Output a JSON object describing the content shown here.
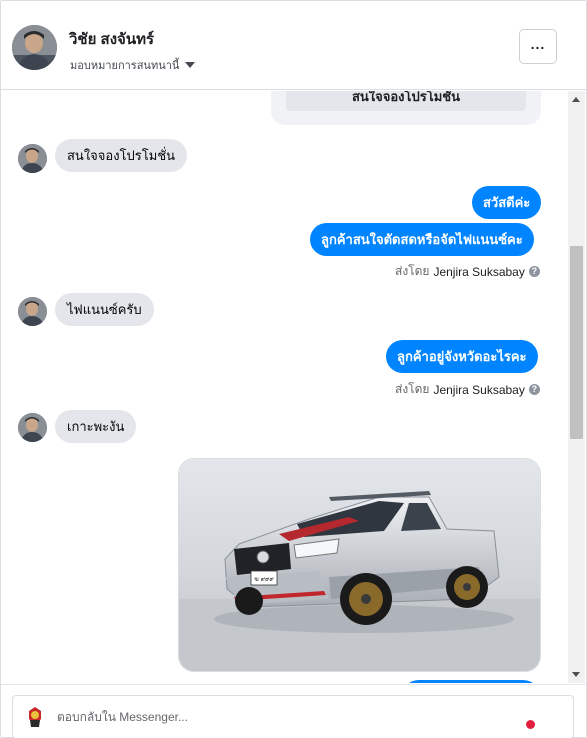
{
  "header": {
    "name": "วิชัย สงจันทร์",
    "assign_label": "มอบหมายการสนทนานี้"
  },
  "conversation": {
    "card_button_label": "สนใจจองโปรโมชัน",
    "messages": [
      {
        "from": "customer",
        "text": "สนใจจองโปรโมชั่น"
      },
      {
        "from": "page",
        "text": "สวัสดีค่ะ"
      },
      {
        "from": "page",
        "text": "ลูกค้าสนใจตัดสดหรือจัดไฟแนนซ์คะ"
      },
      {
        "from": "customer",
        "text": "ไฟแนนซ์ครับ"
      },
      {
        "from": "page",
        "text": "ลูกค้าอยู่จังหวัดอะไรคะ"
      },
      {
        "from": "customer",
        "text": "เกาะพะงัน"
      }
    ],
    "sent_by_prefix": "ส่งโดย",
    "sent_by_name": "Jenjira Suksabay",
    "photo_plate_text": "ฆ ๙๙๙"
  },
  "composer": {
    "placeholder": "ตอบกลับใน Messenger..."
  },
  "colors": {
    "outgoing_bubble": "#0084ff",
    "incoming_bubble": "#e4e6eb",
    "notification_dot": "#e41e3f"
  },
  "icons": [
    "more-options-icon",
    "dropdown-caret-icon",
    "info-icon",
    "scroll-up-arrow-icon",
    "scroll-down-arrow-icon"
  ]
}
